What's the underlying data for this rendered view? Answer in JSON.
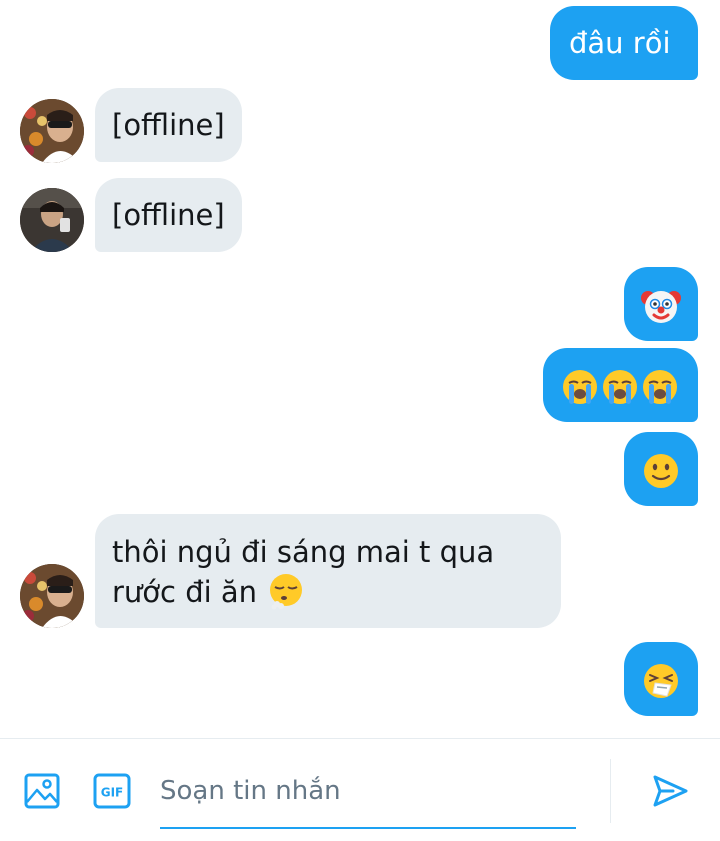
{
  "messages": [
    {
      "side": "out",
      "text": "đâu rồi"
    },
    {
      "side": "in",
      "text": "[offline]"
    },
    {
      "side": "in",
      "text": "[offline]"
    },
    {
      "side": "out",
      "emoji": [
        "clown-face"
      ]
    },
    {
      "side": "out",
      "emoji": [
        "loudly-crying-face",
        "loudly-crying-face",
        "loudly-crying-face"
      ]
    },
    {
      "side": "out",
      "emoji": [
        "slightly-smiling-face"
      ]
    },
    {
      "side": "in",
      "text_line1": "thôi ngủ đi sáng mai t qua",
      "text_line2": "rước đi ăn",
      "emoji": [
        "face-exhaling"
      ]
    },
    {
      "side": "out",
      "emoji": [
        "sneezing-face"
      ]
    }
  ],
  "composer": {
    "placeholder": "Soạn tin nhắn",
    "gif_label": "GIF",
    "icons": [
      "image-icon",
      "gif-icon",
      "send-icon"
    ]
  },
  "colors": {
    "outgoing_bubble": "#1da1f2",
    "incoming_bubble": "#e6ecf0",
    "accent": "#1da1f2",
    "placeholder_text": "#657786"
  }
}
